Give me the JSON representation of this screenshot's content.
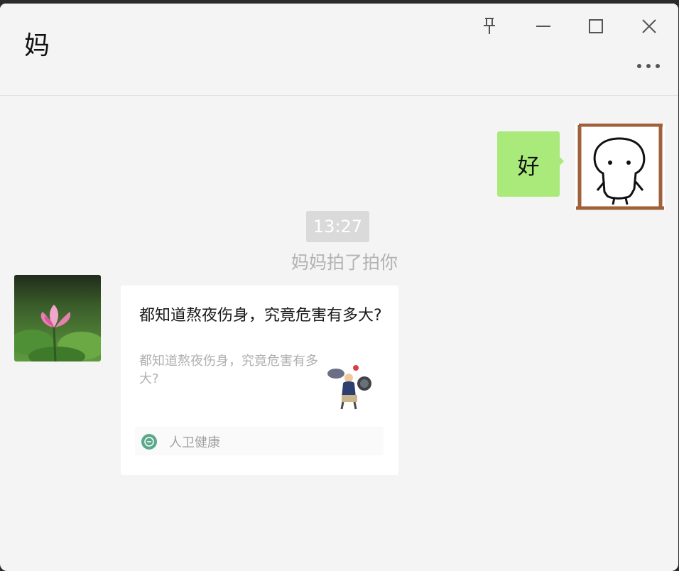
{
  "window": {
    "title": "妈"
  },
  "controls": {
    "pin_icon": "pin-icon",
    "minimize_icon": "minimize-icon",
    "maximize_icon": "maximize-icon",
    "close_icon": "close-icon",
    "more_icon": "more-icon"
  },
  "messages": {
    "self_text": "好",
    "timestamp": "13:27",
    "system_notice": "妈妈拍了拍你",
    "card": {
      "title": "都知道熬夜伤身，究竟危害有多大?",
      "description": "都知道熬夜伤身，究竟危害有多大?",
      "source": "人卫健康"
    }
  },
  "colors": {
    "self_bubble": "#a9ea7a",
    "background": "#f4f4f4",
    "avatar_frame": "#a0603a"
  }
}
